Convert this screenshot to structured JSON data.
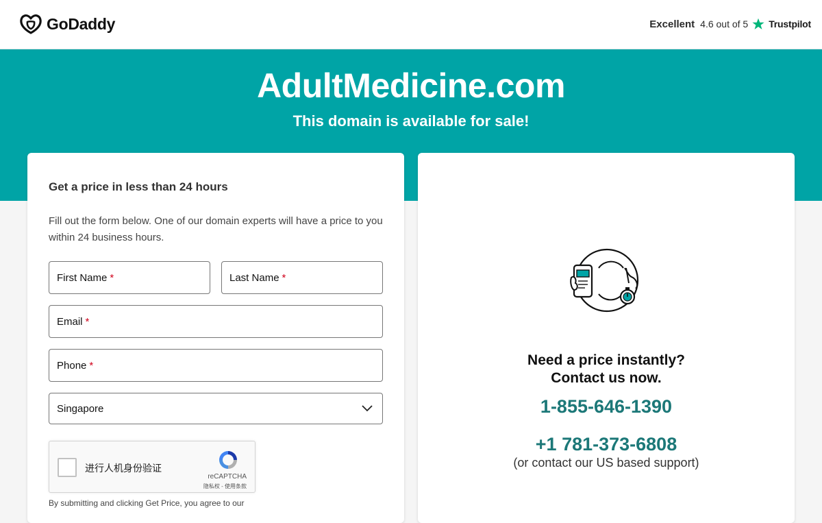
{
  "header": {
    "logo_text": "GoDaddy",
    "trustpilot": {
      "label": "Excellent",
      "rating": "4.6 out of 5",
      "brand": "Trustpilot"
    }
  },
  "hero": {
    "domain": "AdultMedicine.com",
    "subtitle": "This domain is available for sale!"
  },
  "form": {
    "title": "Get a price in less than 24 hours",
    "description": "Fill out the form below. One of our domain experts will have a price to you within 24 business hours.",
    "first_name": "First Name",
    "last_name": "Last Name",
    "email": "Email",
    "phone": "Phone",
    "required_marker": "*",
    "country": "Singapore",
    "recaptcha": {
      "label": "进行人机身份验证",
      "brand": "reCAPTCHA",
      "links": "隐私权 - 使用条款"
    },
    "terms": "By submitting and clicking Get Price, you agree to our"
  },
  "contact": {
    "heading_line1": "Need a price instantly?",
    "heading_line2": "Contact us now.",
    "phone_1": "1-855-646-1390",
    "phone_2": "+1 781-373-6808",
    "support_note": "(or contact our US based support)"
  },
  "colors": {
    "hero_bg": "#00a4a6",
    "phone_text": "#1c7878",
    "trustpilot_star": "#00b67a",
    "required": "#d0021b"
  }
}
